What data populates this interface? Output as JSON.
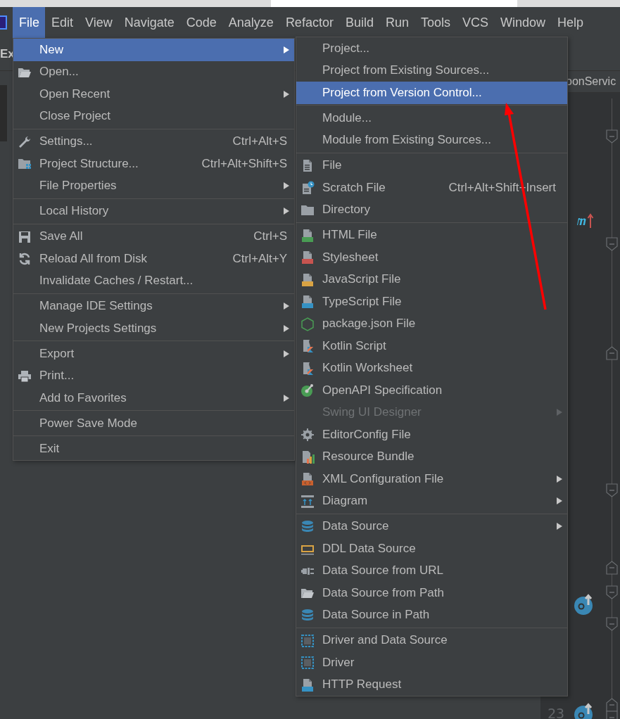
{
  "menu_bar": [
    {
      "label": "File",
      "selected": true
    },
    {
      "label": "Edit",
      "selected": false
    },
    {
      "label": "View",
      "selected": false
    },
    {
      "label": "Navigate",
      "selected": false
    },
    {
      "label": "Code",
      "selected": false
    },
    {
      "label": "Analyze",
      "selected": false
    },
    {
      "label": "Refactor",
      "selected": false
    },
    {
      "label": "Build",
      "selected": false
    },
    {
      "label": "Run",
      "selected": false
    },
    {
      "label": "Tools",
      "selected": false
    },
    {
      "label": "VCS",
      "selected": false
    },
    {
      "label": "Window",
      "selected": false
    },
    {
      "label": "Help",
      "selected": false
    }
  ],
  "toolbar": {
    "text": "Ex"
  },
  "editor": {
    "tab": "oonServic",
    "line_number": "23"
  },
  "file_menu": {
    "groups": [
      [
        {
          "label": "New",
          "submenu": true,
          "selected": true
        },
        {
          "label": "Open...",
          "submenu": false,
          "selected": false
        },
        {
          "label": "Open Recent",
          "submenu": true,
          "selected": false
        },
        {
          "label": "Close Project",
          "submenu": false,
          "selected": false
        }
      ],
      [
        {
          "label": "Settings...",
          "shortcut": "Ctrl+Alt+S",
          "submenu": false,
          "selected": false
        },
        {
          "label": "Project Structure...",
          "shortcut": "Ctrl+Alt+Shift+S",
          "submenu": false,
          "selected": false
        },
        {
          "label": "File Properties",
          "submenu": true,
          "selected": false
        }
      ],
      [
        {
          "label": "Local History",
          "submenu": true,
          "selected": false
        }
      ],
      [
        {
          "label": "Save All",
          "shortcut": "Ctrl+S",
          "submenu": false,
          "selected": false
        },
        {
          "label": "Reload All from Disk",
          "shortcut": "Ctrl+Alt+Y",
          "submenu": false,
          "selected": false
        },
        {
          "label": "Invalidate Caches / Restart...",
          "submenu": false,
          "selected": false
        }
      ],
      [
        {
          "label": "Manage IDE Settings",
          "submenu": true,
          "selected": false
        },
        {
          "label": "New Projects Settings",
          "submenu": true,
          "selected": false
        }
      ],
      [
        {
          "label": "Export",
          "submenu": true,
          "selected": false
        },
        {
          "label": "Print...",
          "submenu": false,
          "selected": false
        },
        {
          "label": "Add to Favorites",
          "submenu": true,
          "selected": false
        }
      ],
      [
        {
          "label": "Power Save Mode",
          "submenu": false,
          "selected": false
        }
      ],
      [
        {
          "label": "Exit",
          "submenu": false,
          "selected": false
        }
      ]
    ]
  },
  "new_submenu": {
    "groups": [
      [
        {
          "label": "Project...",
          "submenu": false,
          "selected": false,
          "disabled": false
        },
        {
          "label": "Project from Existing Sources...",
          "submenu": false,
          "selected": false,
          "disabled": false
        },
        {
          "label": "Project from Version Control...",
          "submenu": false,
          "selected": true,
          "disabled": false
        }
      ],
      [
        {
          "label": "Module...",
          "submenu": false,
          "selected": false,
          "disabled": false
        },
        {
          "label": "Module from Existing Sources...",
          "submenu": false,
          "selected": false,
          "disabled": false
        }
      ],
      [
        {
          "label": "File",
          "submenu": false,
          "selected": false,
          "disabled": false
        },
        {
          "label": "Scratch File",
          "shortcut": "Ctrl+Alt+Shift+Insert",
          "submenu": false,
          "selected": false,
          "disabled": false
        },
        {
          "label": "Directory",
          "submenu": false,
          "selected": false,
          "disabled": false
        }
      ],
      [
        {
          "label": "HTML File",
          "submenu": false,
          "selected": false,
          "disabled": false
        },
        {
          "label": "Stylesheet",
          "submenu": false,
          "selected": false,
          "disabled": false
        },
        {
          "label": "JavaScript File",
          "submenu": false,
          "selected": false,
          "disabled": false
        },
        {
          "label": "TypeScript File",
          "submenu": false,
          "selected": false,
          "disabled": false
        },
        {
          "label": "package.json File",
          "submenu": false,
          "selected": false,
          "disabled": false
        },
        {
          "label": "Kotlin Script",
          "submenu": false,
          "selected": false,
          "disabled": false
        },
        {
          "label": "Kotlin Worksheet",
          "submenu": false,
          "selected": false,
          "disabled": false
        },
        {
          "label": "OpenAPI Specification",
          "submenu": false,
          "selected": false,
          "disabled": false
        },
        {
          "label": "Swing UI Designer",
          "submenu": true,
          "selected": false,
          "disabled": true
        },
        {
          "label": "EditorConfig File",
          "submenu": false,
          "selected": false,
          "disabled": false
        },
        {
          "label": "Resource Bundle",
          "submenu": false,
          "selected": false,
          "disabled": false
        },
        {
          "label": "XML Configuration File",
          "submenu": true,
          "selected": false,
          "disabled": false
        },
        {
          "label": "Diagram",
          "submenu": true,
          "selected": false,
          "disabled": false
        }
      ],
      [
        {
          "label": "Data Source",
          "submenu": true,
          "selected": false,
          "disabled": false
        },
        {
          "label": "DDL Data Source",
          "submenu": false,
          "selected": false,
          "disabled": false
        },
        {
          "label": "Data Source from URL",
          "submenu": false,
          "selected": false,
          "disabled": false
        },
        {
          "label": "Data Source from Path",
          "submenu": false,
          "selected": false,
          "disabled": false
        },
        {
          "label": "Data Source in Path",
          "submenu": false,
          "selected": false,
          "disabled": false
        }
      ],
      [
        {
          "label": "Driver and Data Source",
          "submenu": false,
          "selected": false,
          "disabled": false
        },
        {
          "label": "Driver",
          "submenu": false,
          "selected": false,
          "disabled": false
        },
        {
          "label": "HTTP Request",
          "submenu": false,
          "selected": false,
          "disabled": false
        }
      ]
    ]
  }
}
